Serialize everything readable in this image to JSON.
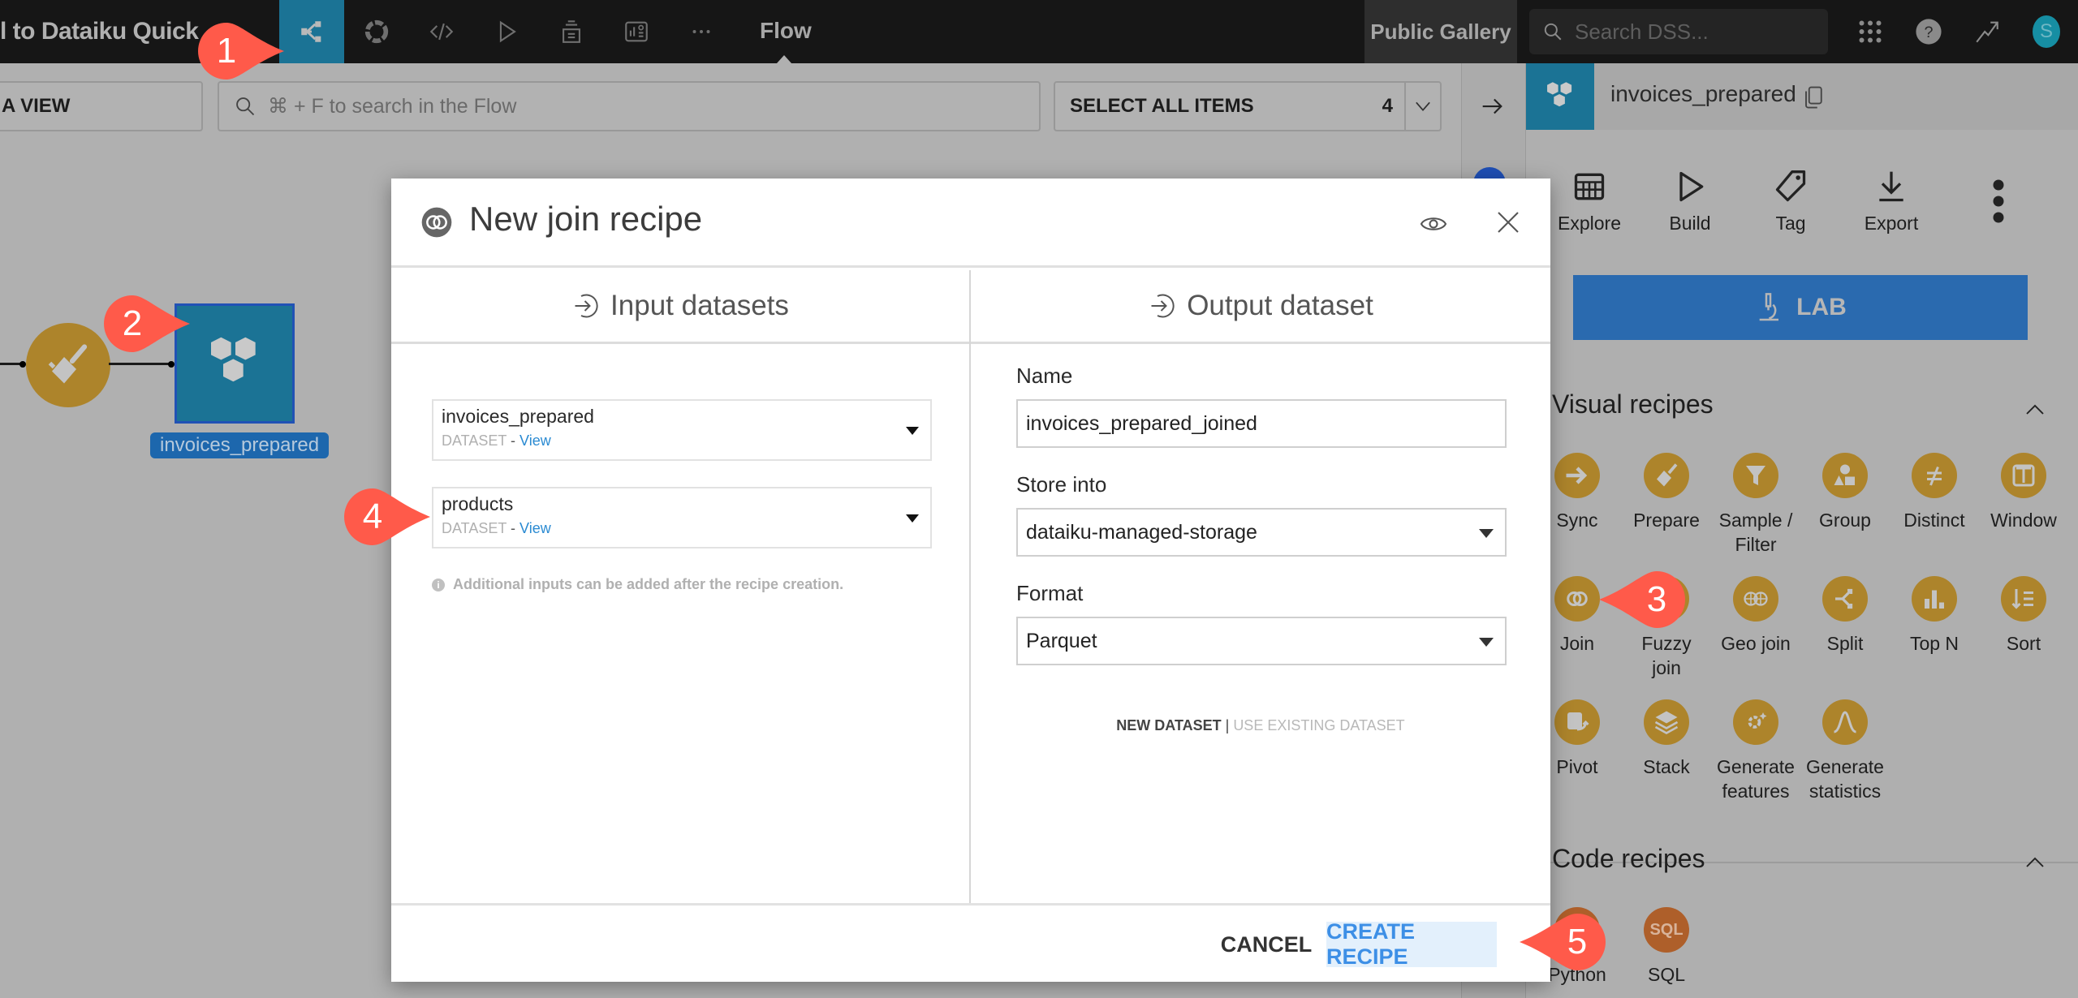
{
  "topbar": {
    "project_title": "l to Dataiku Quick",
    "active_section": "Flow",
    "public_gallery": "Public Gallery",
    "search_placeholder": "Search DSS...",
    "avatar_initial": "S",
    "nav_icons": [
      "flow-icon",
      "lifecycle-icon",
      "code-icon",
      "run-icon",
      "deploy-icon",
      "dashboard-icon",
      "more-icon"
    ]
  },
  "flow_toolbar": {
    "view_button": "A VIEW",
    "search_placeholder": "⌘ + F to search in the Flow",
    "select_all_label": "SELECT ALL ITEMS",
    "select_all_count": "4"
  },
  "flow_canvas": {
    "dataset_label": "invoices_prepared"
  },
  "modal": {
    "title": "New join recipe",
    "input_header": "Input datasets",
    "output_header": "Output dataset",
    "inputs": [
      {
        "name": "invoices_prepared",
        "type": "DATASET",
        "sep": " - ",
        "link": "View"
      },
      {
        "name": "products",
        "type": "DATASET",
        "sep": " - ",
        "link": "View"
      }
    ],
    "additional_note": "Additional inputs can be added after the recipe creation.",
    "output": {
      "name_label": "Name",
      "name_value": "invoices_prepared_joined",
      "store_label": "Store into",
      "store_value": "dataiku-managed-storage",
      "format_label": "Format",
      "format_value": "Parquet",
      "mode_new": "NEW DATASET",
      "mode_sep": " | ",
      "mode_existing": "USE EXISTING DATASET"
    },
    "cancel": "CANCEL",
    "create": "CREATE RECIPE"
  },
  "right_panel": {
    "dataset_title": "invoices_prepared",
    "actions": [
      "Explore",
      "Build",
      "Tag",
      "Export"
    ],
    "lab": "LAB",
    "visual_recipes_title": "Visual recipes",
    "visual_recipes": [
      [
        "Sync"
      ],
      [
        "Prepare"
      ],
      [
        "Sample /",
        "Filter"
      ],
      [
        "Group"
      ],
      [
        "Distinct"
      ],
      [
        "Window"
      ],
      [
        "Join"
      ],
      [
        "Fuzzy",
        "join"
      ],
      [
        "Geo join"
      ],
      [
        "Split"
      ],
      [
        "Top N"
      ],
      [
        "Sort"
      ],
      [
        "Pivot"
      ],
      [
        "Stack"
      ],
      [
        "Generate",
        "features"
      ],
      [
        "Generate",
        "statistics"
      ]
    ],
    "code_recipes_title": "Code recipes",
    "code_recipes": [
      "Python",
      "SQL"
    ],
    "sql_icon_text": "SQL"
  },
  "callouts": [
    "1",
    "2",
    "3",
    "4",
    "5"
  ],
  "colors": {
    "accent_flow": "#1b7395",
    "recipe_visual": "#ad842b",
    "recipe_code": "#ae5f2a",
    "lab_button": "#2a6aaf",
    "create_text": "#3d8fe6",
    "callout": "#ff5a4a"
  }
}
